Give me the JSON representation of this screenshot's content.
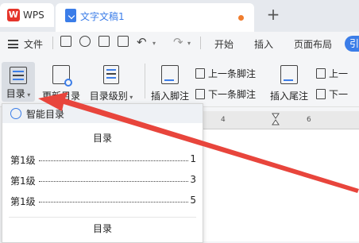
{
  "tabs": {
    "app_label": "WPS",
    "doc_label": "文字文稿1"
  },
  "menubar": {
    "file_label": "文件",
    "items": [
      "开始",
      "插入",
      "页面布局"
    ],
    "pill_label": "引"
  },
  "ribbon": {
    "toc_label": "目录",
    "update_toc_label": "更新目录",
    "toc_level_label": "目录级别",
    "insert_footnote_label": "插入脚注",
    "prev_footnote_label": "上一条脚注",
    "next_footnote_label": "下一条脚注",
    "insert_endnote_label": "插入尾注",
    "prev_endnote_label": "上一",
    "next_endnote_label": "下一"
  },
  "ruler": {
    "ticks": [
      "4",
      "6"
    ]
  },
  "dropdown": {
    "smart_toc_label": "智能目录",
    "preview1": {
      "title": "目录",
      "rows": [
        {
          "level": "第1级",
          "page": "1"
        },
        {
          "level": "第1级",
          "page": "3"
        },
        {
          "level": "第1级",
          "page": "5"
        }
      ]
    },
    "preview2_title": "目录"
  },
  "colors": {
    "accent": "#3b7de8",
    "arrow": "#e8453c",
    "wps_red": "#e5352b"
  }
}
